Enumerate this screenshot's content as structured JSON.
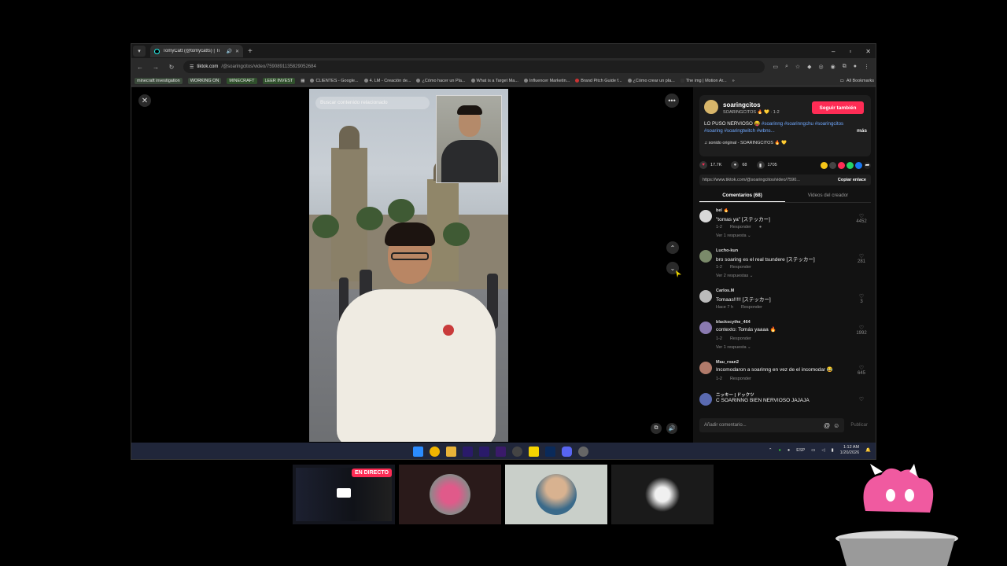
{
  "browser": {
    "tab_title": "TomyCatt (@tomycatts) | Ti",
    "url_host": "tiktok.com",
    "url_path": "/@soaringcitos/video/7590891135829052684",
    "bookmarks": [
      {
        "label": "minecraft investigation",
        "kind": "chip"
      },
      {
        "label": "WORKING ON",
        "kind": "chip"
      },
      {
        "label": "MINECRAFT",
        "kind": "chip-green"
      },
      {
        "label": "LEER INVEST",
        "kind": "chip-green"
      },
      {
        "label": "CLIENTES - Google...",
        "kind": "item"
      },
      {
        "label": "4. LM - Creación de...",
        "kind": "item"
      },
      {
        "label": "¿Cómo hacer un Pla...",
        "kind": "item"
      },
      {
        "label": "What is a Target Ma...",
        "kind": "item"
      },
      {
        "label": "Influencer Marketin...",
        "kind": "item"
      },
      {
        "label": "Brand Pitch Guide f...",
        "kind": "item"
      },
      {
        "label": "¿Cómo crear un pla...",
        "kind": "item"
      },
      {
        "label": "The img | Motion Ar...",
        "kind": "item"
      }
    ],
    "all_bookmarks": "All Bookmarks"
  },
  "video": {
    "search_placeholder": "Buscar contenido relacionado"
  },
  "post": {
    "username": "soaringcitos",
    "display_name": "SOARINGCITOS 🔥 💛 · 1-2",
    "follow_label": "Seguir también",
    "desc_text": "LO PUSO NERVIOSO 😝 ",
    "desc_tags": "#soarinng #soarinngchu #soaringcitos #soaring #soaringtwitch #wbns...",
    "more_label": "más",
    "sound": "♫ sonido original - SOARINGCITOS 🔥 💛",
    "likes": "17.7K",
    "comments_count": "68",
    "saves": "1705",
    "link": "https://www.tiktok.com/@soaringcitos/video/7590...",
    "copy_label": "Copiar enlace"
  },
  "tabs": {
    "comments": "Comentarios (68)",
    "creator_videos": "Videos del creador"
  },
  "comments": [
    {
      "name": "bel 🔥",
      "text": "\"tomas ya\" [ステッカー]",
      "time": "1-2",
      "reply": "Responder",
      "likes": "4452",
      "replies": "Ver 1 respuesta ⌄",
      "avatar_color": "#d8d8d8"
    },
    {
      "name": "Lucho-kun",
      "text": "bro soaring es el real tsundere [ステッカー]",
      "time": "1-2",
      "reply": "Responder",
      "likes": "281",
      "replies": "Ver 2 respuestas ⌄",
      "avatar_color": "#7a8a6a"
    },
    {
      "name": "Carlos.M",
      "text": "Tomaas!!!!! [ステッカー]",
      "time": "Hace 7 h",
      "reply": "Responder",
      "likes": "3",
      "replies": "",
      "avatar_color": "#bbbbbb"
    },
    {
      "name": "blackscythe_464",
      "text": "contexto: Tomás yaaaa 🔥",
      "time": "1-2",
      "reply": "Responder",
      "likes": "1992",
      "replies": "Ver 1 respuesta ⌄",
      "avatar_color": "#8a7ab0"
    },
    {
      "name": "Mau_roan2",
      "text": "Incomodaron a soarinng en vez de el incomodar 😂",
      "time": "1-2",
      "reply": "Responder",
      "likes": "645",
      "replies": "",
      "avatar_color": "#b07a6a"
    },
    {
      "name": "ニッキー | ドックツ",
      "text": "C SOARINNG BIEN NERVIOSO JAJAJA",
      "time": "",
      "reply": "",
      "likes": "",
      "replies": "",
      "avatar_color": "#5a6ab0"
    }
  ],
  "comment_input": {
    "placeholder": "Añadir comentario...",
    "publish": "Publicar"
  },
  "taskbar": {
    "lang": "ESP",
    "time": "1:12 AM",
    "date": "1/20/2026"
  },
  "stream": {
    "live_badge": "EN DIRECTO"
  }
}
